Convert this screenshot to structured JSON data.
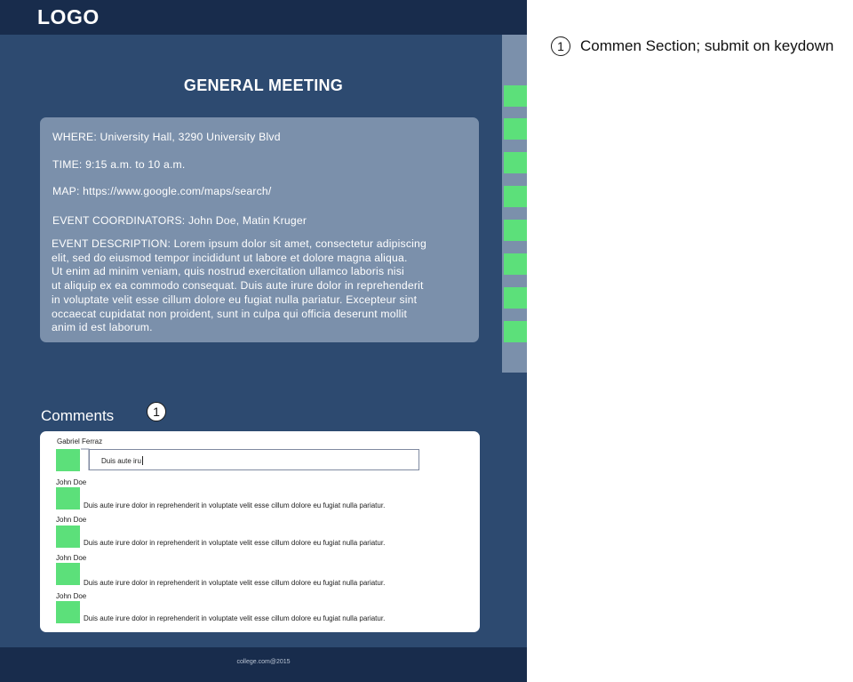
{
  "header": {
    "logo": "LOGO"
  },
  "event": {
    "title": "GENERAL MEETING",
    "where": "WHERE: University Hall, 3290 University Blvd",
    "time": "TIME: 9:15 a.m. to 10 a.m.",
    "map": "MAP: https://www.google.com/maps/search/",
    "coordinators": "EVENT COORDINATORS: John Doe, Matin Kruger",
    "description": "EVENT DESCRIPTION: Lorem ipsum dolor sit amet, consectetur adipiscing\nelit, sed do eiusmod tempor incididunt ut labore et dolore magna aliqua.\nUt enim ad minim veniam, quis nostrud exercitation ullamco laboris nisi\nut aliquip ex ea commodo consequat. Duis aute irure dolor in reprehenderit\n in voluptate velit esse cillum dolore eu fugiat nulla pariatur. Excepteur sint\noccaecat cupidatat non proident,  sunt in culpa qui officia deserunt mollit\nanim id est laborum."
  },
  "comments": {
    "heading": "Comments",
    "callout": "1",
    "composer": {
      "author": "Gabriel Ferraz",
      "value": "Duis aute iru"
    },
    "items": [
      {
        "author": "John Doe",
        "text": "Duis aute irure dolor in reprehenderit  in voluptate velit esse cillum dolore eu fugiat nulla pariatur."
      },
      {
        "author": "John Doe",
        "text": "Duis aute irure dolor in reprehenderit  in voluptate velit esse cillum dolore eu fugiat nulla pariatur."
      },
      {
        "author": "John Doe",
        "text": "Duis aute irure dolor in reprehenderit  in voluptate velit esse cillum dolore eu fugiat nulla pariatur."
      },
      {
        "author": "John Doe",
        "text": "Duis aute irure dolor in reprehenderit  in voluptate velit esse cillum dolore eu fugiat nulla pariatur."
      }
    ]
  },
  "footer": {
    "copyright": "college.com@2015"
  },
  "annotation": {
    "number": "1",
    "text": "Commen Section; submit on keydown"
  },
  "colors": {
    "page_bg": "#2d4a70",
    "bar_bg": "#182c4c",
    "card_bg": "#7b90ab",
    "avatar_green": "#5ce07a"
  }
}
